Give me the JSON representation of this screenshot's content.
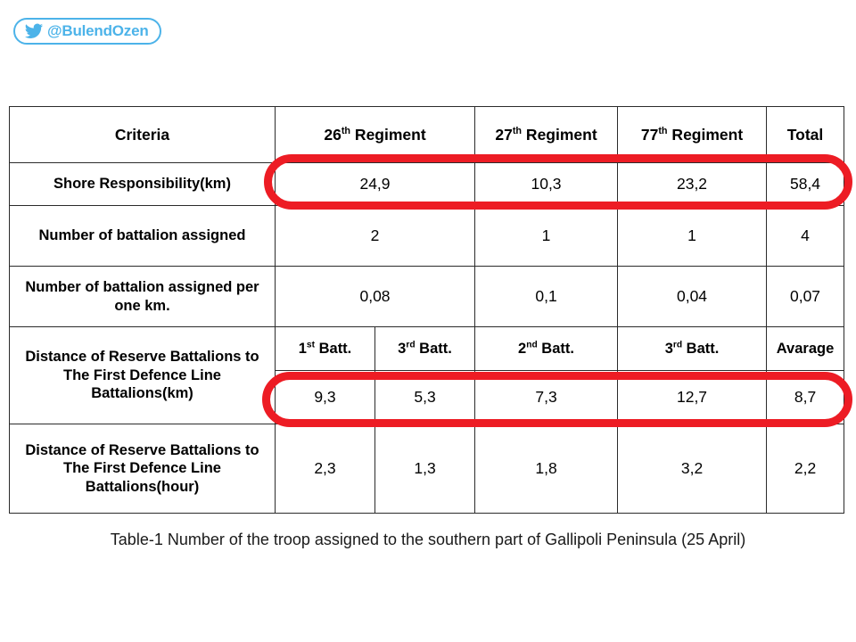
{
  "badge": {
    "icon": "twitter-bird-icon",
    "handle": "@BulendOzen",
    "color": "#4cb3e9"
  },
  "table": {
    "columns": [
      "Criteria",
      "26th Regiment",
      "27th Regiment",
      "77th Regiment",
      "Total"
    ],
    "header": {
      "criteria": "Criteria",
      "reg26_num": "26",
      "reg26_suffix": "th",
      "reg26_word": " Regiment",
      "reg27_num": "27",
      "reg27_suffix": "th",
      "reg27_word": " Regiment",
      "reg77_num": "77",
      "reg77_suffix": "th",
      "reg77_word": " Regiment",
      "total": "Total"
    },
    "rows": {
      "shore": {
        "criteria": "Shore Responsibility(km)",
        "reg26": "24,9",
        "reg27": "10,3",
        "reg77": "23,2",
        "total": "58,4"
      },
      "battalion_count": {
        "criteria": "Number of battalion assigned",
        "reg26": "2",
        "reg27": "1",
        "reg77": "1",
        "total": "4"
      },
      "battalion_per_km": {
        "criteria": "Number of battalion assigned per one km.",
        "reg26": "0,08",
        "reg27": "0,1",
        "reg77": "0,04",
        "total": "0,07"
      },
      "distance_km": {
        "criteria": "Distance of Reserve Battalions to The First Defence Line Battalions(km)",
        "subheaders": {
          "b1_num": "1",
          "b1_suffix": "st",
          "b1_word": " Batt.",
          "b2_num": "3",
          "b2_suffix": "rd",
          "b2_word": " Batt.",
          "b3_num": "2",
          "b3_suffix": "nd",
          "b3_word": " Batt.",
          "b4_num": "3",
          "b4_suffix": "rd",
          "b4_word": " Batt.",
          "average": "Avarage"
        },
        "v1": "9,3",
        "v2": "5,3",
        "v3": "7,3",
        "v4": "12,7",
        "avg": "8,7"
      },
      "distance_hour": {
        "criteria": "Distance of Reserve Battalions to The First Defence Line Battalions(hour)",
        "v1": "2,3",
        "v2": "1,3",
        "v3": "1,8",
        "v4": "3,2",
        "avg": "2,2"
      }
    },
    "highlights": {
      "color": "#ed1c24",
      "rows": [
        "shore",
        "distance_km"
      ]
    }
  },
  "caption": "Table-1 Number of the troop assigned to the southern part of Gallipoli Peninsula (25 April)",
  "chart_data": {
    "type": "table",
    "title": "Table-1 Number of the troop assigned to the southern part of Gallipoli Peninsula (25 April)",
    "columns": [
      "Criteria",
      "26th Regiment",
      "27th Regiment",
      "77th Regiment",
      "Total"
    ],
    "rows": [
      {
        "criteria": "Shore Responsibility(km)",
        "values": [
          "24,9",
          "10,3",
          "23,2",
          "58,4"
        ],
        "highlighted": true
      },
      {
        "criteria": "Number of battalion assigned",
        "values": [
          "2",
          "1",
          "1",
          "4"
        ],
        "highlighted": false
      },
      {
        "criteria": "Number of battalion assigned per one km.",
        "values": [
          "0,08",
          "0,1",
          "0,04",
          "0,07"
        ],
        "highlighted": false
      },
      {
        "criteria": "Distance of Reserve Battalions to The First Defence Line Battalions(km)",
        "subcolumns": [
          "1st Batt.",
          "3rd Batt.",
          "2nd Batt.",
          "3rd Batt.",
          "Avarage"
        ],
        "values": [
          "9,3",
          "5,3",
          "7,3",
          "12,7",
          "8,7"
        ],
        "highlighted": true
      },
      {
        "criteria": "Distance of Reserve Battalions to The First Defence Line Battalions(hour)",
        "subcolumns": [
          "1st Batt.",
          "3rd Batt.",
          "2nd Batt.",
          "3rd Batt.",
          "Avarage"
        ],
        "values": [
          "2,3",
          "1,3",
          "1,8",
          "3,2",
          "2,2"
        ],
        "highlighted": false
      }
    ]
  }
}
